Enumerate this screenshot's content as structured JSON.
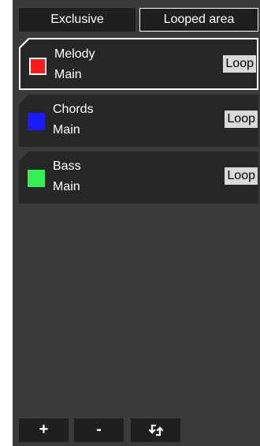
{
  "tabs": {
    "exclusive_label": "Exclusive",
    "looped_label": "Looped area"
  },
  "tracks": [
    {
      "name": "Melody",
      "sub": "Main",
      "color": "#ff1a1a",
      "loop_label": "Loop",
      "selected": true
    },
    {
      "name": "Chords",
      "sub": "Main",
      "color": "#1a1aff",
      "loop_label": "Loop",
      "selected": false
    },
    {
      "name": "Bass",
      "sub": "Main",
      "color": "#33ee55",
      "loop_label": "Loop",
      "selected": false
    }
  ],
  "footer": {
    "add_label": "+",
    "remove_label": "-",
    "swap_icon": "swap-arrows-icon"
  }
}
